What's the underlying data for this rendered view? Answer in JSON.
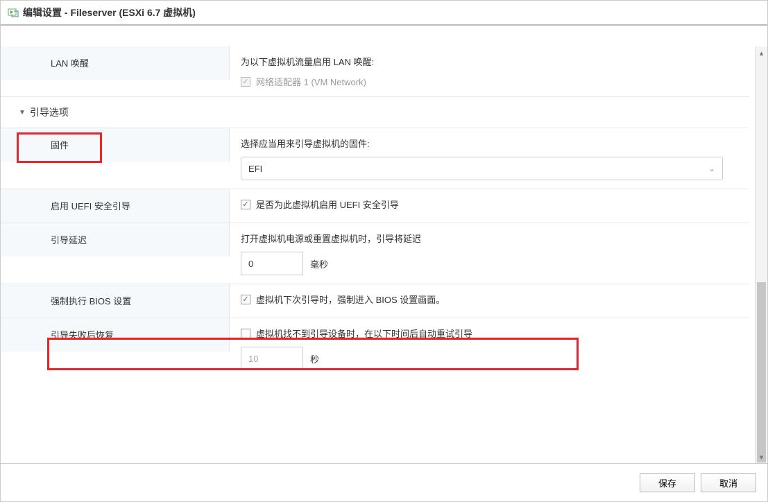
{
  "window": {
    "title": "编辑设置 - Fileserver (ESXi 6.7 虚拟机)"
  },
  "rows": {
    "lan_wake": {
      "label": "LAN 唤醒",
      "desc": "为以下虚拟机流量启用 LAN 唤醒:",
      "adapter_label": "网络适配器 1 (VM Network)"
    },
    "boot_section": {
      "label": "引导选项"
    },
    "firmware": {
      "label": "固件",
      "desc": "选择应当用来引导虚拟机的固件:",
      "selected": "EFI"
    },
    "uefi_secure": {
      "label": "启用 UEFI 安全引导",
      "checkbox_label": "是否为此虚拟机启用 UEFI 安全引导"
    },
    "boot_delay": {
      "label": "引导延迟",
      "desc": "打开虚拟机电源或重置虚拟机时，引导将延迟",
      "value": "0",
      "unit": "毫秒"
    },
    "force_bios": {
      "label": "强制执行 BIOS 设置",
      "checkbox_label": "虚拟机下次引导时，强制进入 BIOS 设置画面。"
    },
    "boot_fail_retry": {
      "label": "引导失败后恢复",
      "checkbox_label": "虚拟机找不到引导设备时，在以下时间后自动重试引导",
      "value": "10",
      "unit": "秒"
    }
  },
  "footer": {
    "save": "保存",
    "cancel": "取消"
  }
}
